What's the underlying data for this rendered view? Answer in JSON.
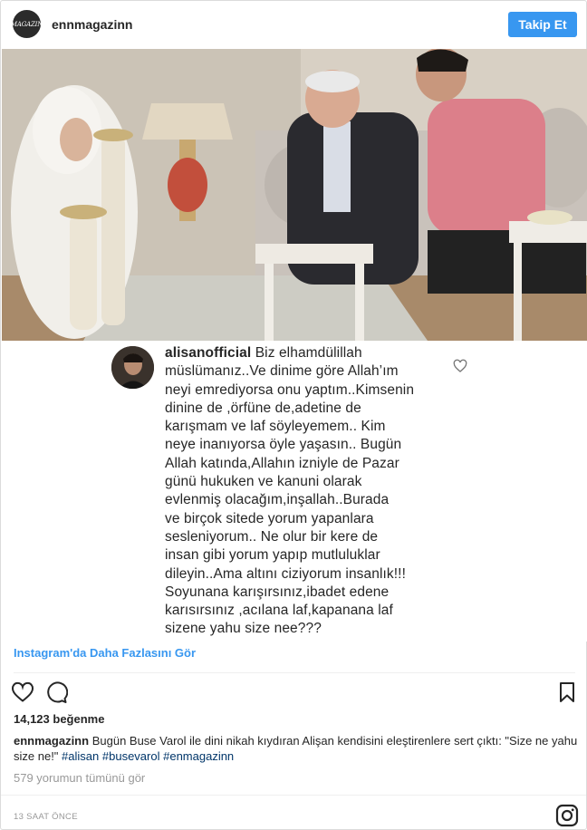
{
  "header": {
    "avatar_text": "MAGAZIN",
    "username": "ennmagazinn",
    "follow_label": "Takip Et"
  },
  "photo": {
    "description_icon": "photo-image"
  },
  "comment": {
    "username": "alisanofficial",
    "lines": [
      "Biz elhamdülillah",
      "müslümanız..Ve dinime göre Allah’ım",
      "neyi emrediyorsa onu yaptım..Kimsenin",
      "dinine de ,örfüne de,adetine de",
      "karışmam ve laf söyleyemem.. Kim",
      "neye inanıyorsa öyle yaşasın.. Bugün",
      "Allah katında,Allahın izniyle de Pazar",
      "günü hukuken ve kanuni olarak",
      "evlenmiş olacağım,inşallah..Burada",
      "ve birçok sitede yorum yapanlara",
      "sesleniyorum.. Ne olur bir kere de",
      "insan gibi yorum yapıp mutluluklar",
      "dileyin..Ama altını ciziyorum insanlık!!!",
      "Soyunana karışırsınız,ibadet edene",
      "karısırsınız ,acılana laf,kapanana laf",
      "sizene yahu size nee???"
    ]
  },
  "more_link": "Instagram'da Daha Fazlasını Gör",
  "likes": "14,123 beğenme",
  "caption": {
    "username": "ennmagazinn",
    "text": "Bugün Buse Varol ile dini nikah kıydıran Alişan kendisini eleştirenlere sert çıktı: \"Size ne yahu size ne!\"",
    "tags": [
      "#alisan",
      "#busevarol",
      "#enmagazinn"
    ]
  },
  "view_all_comments": "579 yorumun tümünü gör",
  "timestamp": "13 SAAT ÖNCE",
  "colors": {
    "accent": "#3897f0",
    "tag": "#003569",
    "muted": "#999999"
  }
}
